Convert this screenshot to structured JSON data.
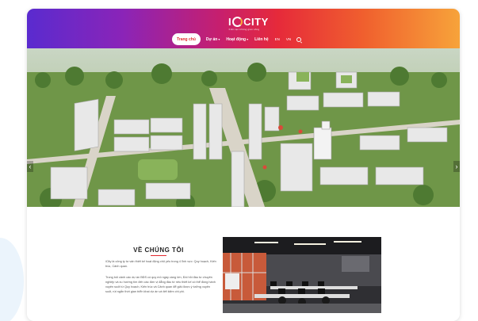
{
  "header": {
    "logo_text": "CITY",
    "logo_prefix": "I",
    "tagline": "Kiến tạo không gian sống",
    "nav": [
      {
        "label": "Trang chủ",
        "active": true
      },
      {
        "label": "Dự án",
        "dropdown": true
      },
      {
        "label": "Hoạt động",
        "dropdown": true
      },
      {
        "label": "Liên hệ"
      }
    ],
    "lang_1": "EN",
    "lang_2": "VN",
    "search_icon": "search-icon"
  },
  "hero": {
    "prev_arrow": "‹",
    "next_arrow": "›",
    "image": "aerial-city-rendering"
  },
  "about": {
    "title": "VỀ CHÚNG TÔI",
    "paragraph_1": "iCity là công ty tư vấn thiết kế hoạt động chủ yếu trong 4 lĩnh vực: Quy hoạch, Kiến trúc, Cảnh quan.",
    "paragraph_2": "Trong bối cảnh các dự án BĐS có quy mô ngày càng lớn, Đòi hỏi đầu tư chuyên nghiệp và xu hướng tìm đến các đơn vị đẳng đầu từ nêu thiết kế có thể đồng hành xuyên suốt từ Quy hoạch, Kiến trúc và Cảnh quan để giải được ý tưởng xuyên suốt, rút ngắn thời gian triển khai dự án và tiết kiệm chi phí.",
    "photo": "office-photo"
  },
  "colors": {
    "header_gradient_start": "#5a2bcf",
    "header_gradient_end": "#f7a33a",
    "accent": "#e3282e"
  }
}
